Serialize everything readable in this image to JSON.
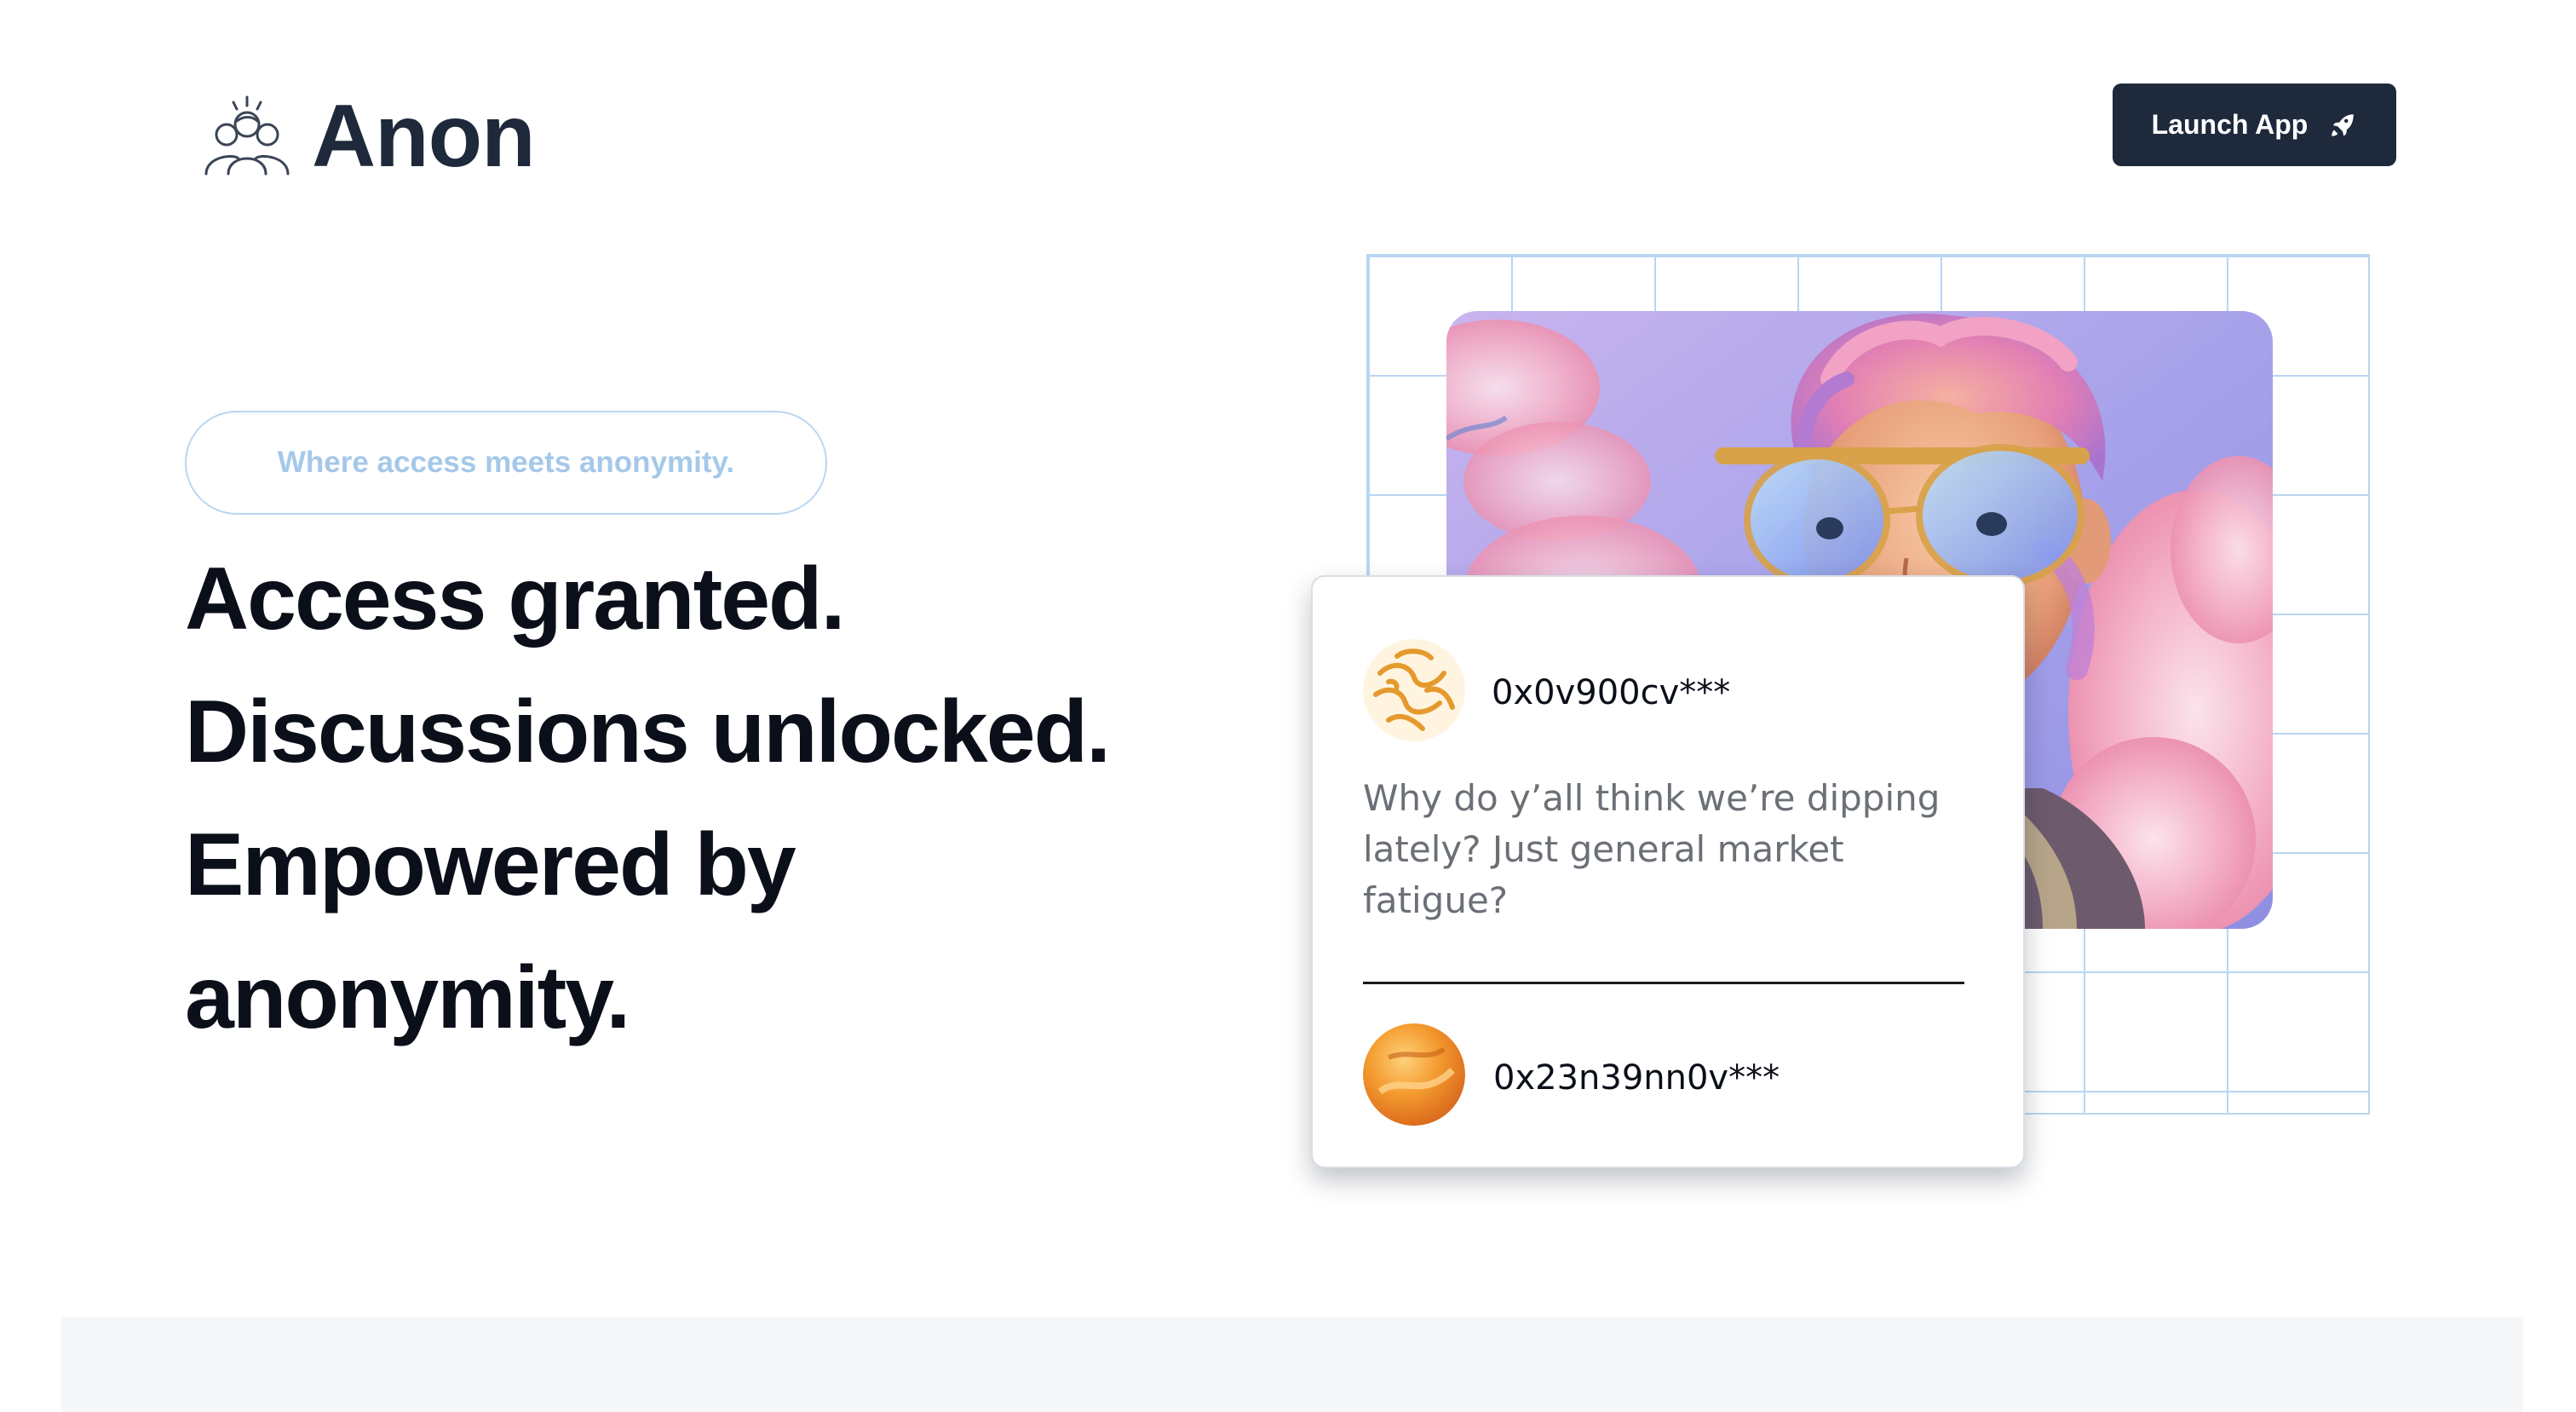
{
  "header": {
    "brand_name": "Anon",
    "logo_icon": "people-group-icon",
    "launch_button_label": "Launch App",
    "launch_button_icon": "rocket-icon"
  },
  "hero": {
    "tagline": "Where access meets anonymity.",
    "headline_lines": [
      "Access granted.",
      "Discussions unlocked.",
      "Empowered by",
      "anonymity."
    ]
  },
  "post_card": {
    "author": "0x0v900cv***",
    "message": "Why do y’all think we’re dipping lately? Just general market fatigue?",
    "reply_author": "0x23n39nn0v***"
  },
  "colors": {
    "primary": "#1e293b",
    "tagline": "#a5c8ea",
    "grid_lines": "#b9d6f2",
    "page_background": "#ffffff",
    "bottom_band": "#f6f7f9"
  }
}
